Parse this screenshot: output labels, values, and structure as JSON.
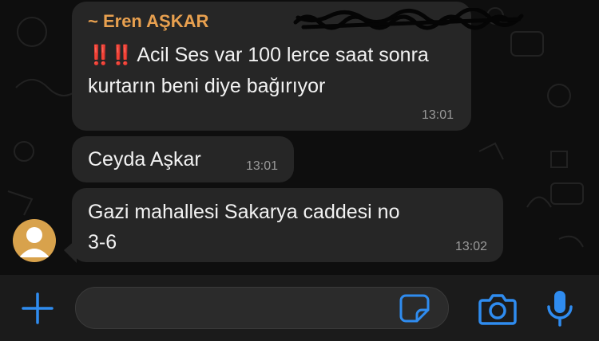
{
  "colors": {
    "chat_background": "#0e0e0e",
    "bubble": "#262626",
    "sender_name": "#e8a04f",
    "accent_blue": "#2f8cf0",
    "exclamation_red": "#e5322d",
    "timestamp": "#9a9a9a"
  },
  "messages": [
    {
      "sender": "~ Eren AŞKAR",
      "emoji": "‼️‼️",
      "text": "Acil Ses var 100 lerce saat sonra kurtarın beni diye bağırıyor",
      "time": "13:01"
    },
    {
      "text": "Ceyda Aşkar",
      "time": "13:01"
    },
    {
      "text": "Gazi mahallesi Sakarya caddesi no\n3-6",
      "time": "13:02"
    }
  ],
  "avatar": {
    "icon": "default-person-avatar-icon"
  },
  "input_bar": {
    "message_value": "",
    "icons": [
      "plus-icon",
      "sticker-icon",
      "camera-icon",
      "microphone-icon"
    ]
  }
}
